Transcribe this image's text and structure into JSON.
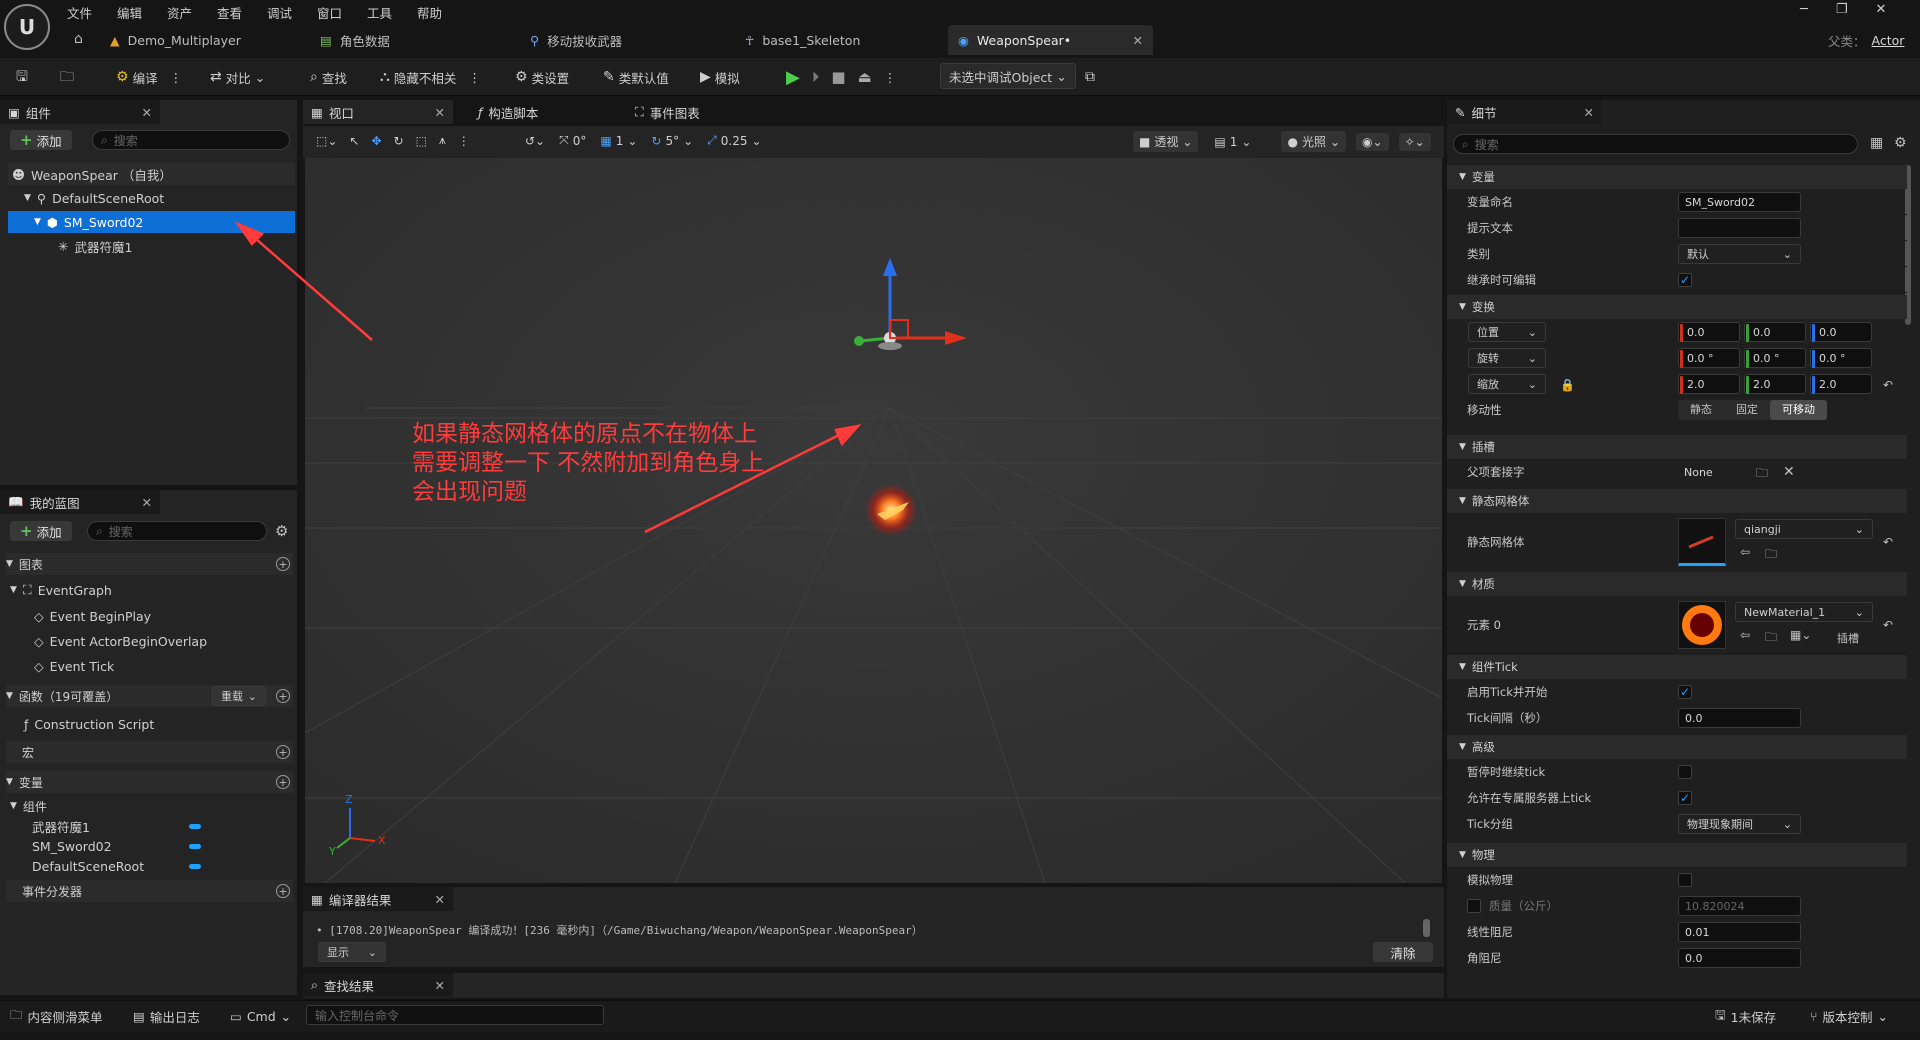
{
  "menu": [
    "文件",
    "编辑",
    "资产",
    "查看",
    "调试",
    "窗口",
    "工具",
    "帮助"
  ],
  "tabs": [
    {
      "label": "Demo_Multiplayer"
    },
    {
      "label": "角色数据"
    },
    {
      "label": "移动拔收武器"
    },
    {
      "label": "base1_Skeleton"
    },
    {
      "label": "WeaponSpear•"
    }
  ],
  "parent_class": {
    "label": "父类：",
    "value": "Actor"
  },
  "toolbar": {
    "compile": "编译",
    "diff": "对比",
    "find": "查找",
    "hide_unrelated": "隐藏不相关",
    "class_settings": "类设置",
    "class_defaults": "类默认值",
    "simulate": "模拟",
    "debug_object": "未选中调试Object"
  },
  "components_panel": {
    "title": "组件",
    "add": "添加",
    "search_placeholder": "搜索",
    "items": [
      {
        "label": "WeaponSpear （自我）"
      },
      {
        "label": "DefaultSceneRoot"
      },
      {
        "label": "SM_Sword02"
      },
      {
        "label": "武器符魔1"
      }
    ]
  },
  "viewport_tabs": {
    "viewport": "视口",
    "construction": "构造脚本",
    "event_graph": "事件图表"
  },
  "viewport_toolbar": {
    "rot_snap": "0°",
    "grid": "1",
    "angle": "5°",
    "scale": "0.25",
    "perspective": "透视",
    "camera_speed": "1",
    "lit": "光照"
  },
  "annotation": {
    "lines": [
      "如果静态网格体的原点不在物体上",
      "需要调整一下 不然附加到角色身上",
      "会出现问题"
    ],
    "color": "#ff3b3b"
  },
  "mybp_panel": {
    "title": "我的蓝图",
    "add": "添加",
    "search_placeholder": "搜索",
    "graphs_label": "图表",
    "event_graph": "EventGraph",
    "events": [
      "Event BeginPlay",
      "Event ActorBeginOverlap",
      "Event Tick"
    ],
    "functions_label": "函数（19可覆盖）",
    "override": "重载",
    "construction_script": "Construction Script",
    "macros_label": "宏",
    "variables_label": "变量",
    "components_label": "组件",
    "variables": [
      "武器符魔1",
      "SM_Sword02",
      "DefaultSceneRoot"
    ],
    "dispatchers_label": "事件分发器"
  },
  "compiler": {
    "title": "编译器结果",
    "message": "[1708.20]WeaponSpear 编译成功！[236 毫秒内]（/Game/Biwuchang/Weapon/WeaponSpear.WeaponSpear）",
    "show": "显示",
    "clear": "清除"
  },
  "find_results": {
    "title": "查找结果"
  },
  "details": {
    "title": "细节",
    "search_placeholder": "搜索",
    "sections": {
      "variable": "变量",
      "transform": "变换",
      "socket": "插槽",
      "static_mesh": "静态网格体",
      "materials": "材质",
      "tick": "组件Tick",
      "advanced": "高级",
      "physics": "物理"
    },
    "variable_name_label": "变量命名",
    "variable_name": "SM_Sword02",
    "tooltip_label": "提示文本",
    "category_label": "类别",
    "category": "默认",
    "editable_label": "继承时可编辑",
    "location": {
      "label": "位置",
      "x": "0.0",
      "y": "0.0",
      "z": "0.0"
    },
    "rotation": {
      "label": "旋转",
      "x": "0.0 °",
      "y": "0.0 °",
      "z": "0.0 °"
    },
    "scale": {
      "label": "缩放",
      "x": "2.0",
      "y": "2.0",
      "z": "2.0"
    },
    "mobility": {
      "label": "移动性",
      "options": [
        "静态",
        "固定",
        "可移动"
      ]
    },
    "parent_socket_label": "父项套接字",
    "parent_socket": "None",
    "static_mesh_label": "静态网格体",
    "static_mesh": "qiangji",
    "element0_label": "元素 0",
    "material": "NewMaterial_1",
    "slot_label": "插槽",
    "start_tick_label": "启用Tick并开始",
    "tick_interval_label": "Tick间隔（秒）",
    "tick_interval": "0.0",
    "tick_paused_label": "暂停时继续tick",
    "tick_server_label": "允许在专属服务器上tick",
    "tick_group_label": "Tick分组",
    "tick_group": "物理现象期间",
    "simulate_physics_label": "模拟物理",
    "mass_label": "质量（公斤）",
    "mass": "10.820024",
    "linear_damping_label": "线性阻尼",
    "linear_damping": "0.01",
    "angular_damping_label": "角阻尼",
    "angular_damping": "0.0"
  },
  "statusbar": {
    "content_drawer": "内容侧滑菜单",
    "output_log": "输出日志",
    "cmd": "Cmd",
    "console_placeholder": "输入控制台命令",
    "unsaved": "1未保存",
    "source_control": "版本控制"
  }
}
